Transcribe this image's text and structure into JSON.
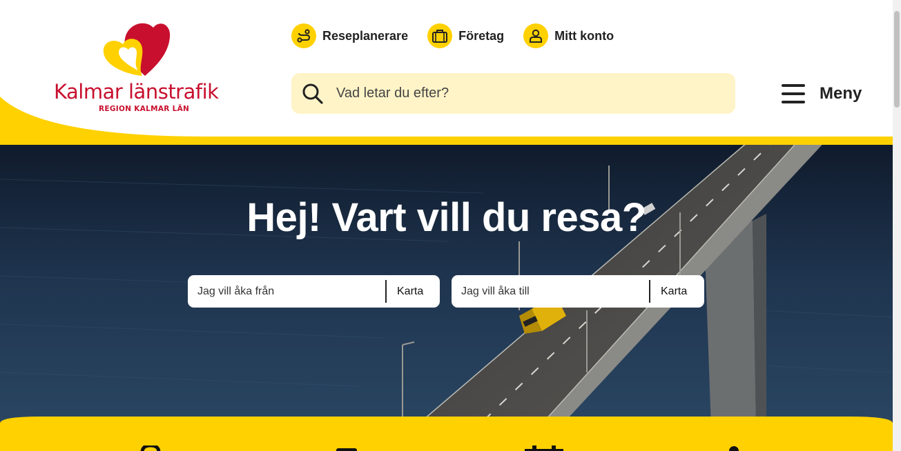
{
  "brand": {
    "name": "Kalmar länstrafik",
    "region": "REGION KALMAR LÄN",
    "red": "#c8102e",
    "yellow": "#ffd100"
  },
  "toplinks": [
    {
      "label": "Reseplanerare",
      "icon": "route-icon"
    },
    {
      "label": "Företag",
      "icon": "briefcase-icon"
    },
    {
      "label": "Mitt konto",
      "icon": "user-icon"
    }
  ],
  "search": {
    "placeholder": "Vad letar du efter?"
  },
  "menu": {
    "label": "Meny"
  },
  "hero": {
    "title": "Hej! Vart vill du resa?",
    "from": {
      "placeholder": "Jag vill åka från",
      "map_label": "Karta"
    },
    "to": {
      "placeholder": "Jag vill åka till",
      "map_label": "Karta"
    }
  },
  "quicklinks": [
    {
      "icon": "location-pin-icon"
    },
    {
      "icon": "ticket-icon"
    },
    {
      "icon": "calendar-icon"
    },
    {
      "icon": "info-icon"
    }
  ]
}
